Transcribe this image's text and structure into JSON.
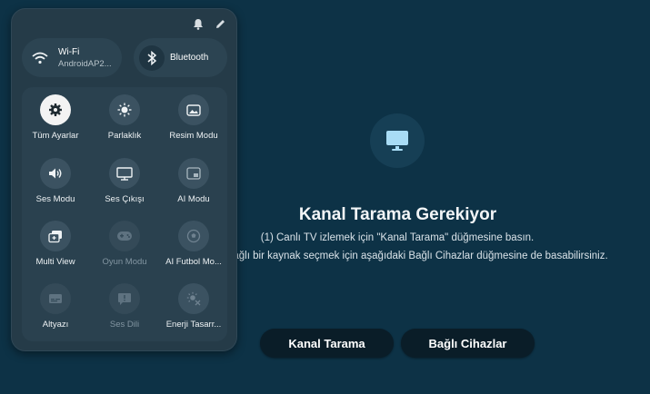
{
  "panel": {
    "wifi": {
      "title": "Wi-Fi",
      "subtitle": "AndroidAP2..."
    },
    "bluetooth": {
      "title": "Bluetooth"
    },
    "tiles": [
      {
        "label": "Tüm Ayarlar",
        "icon": "gear-icon"
      },
      {
        "label": "Parlaklık",
        "icon": "brightness-icon"
      },
      {
        "label": "Resim Modu",
        "icon": "picture-icon"
      },
      {
        "label": "Ses Modu",
        "icon": "speaker-icon"
      },
      {
        "label": "Ses Çıkışı",
        "icon": "monitor-icon"
      },
      {
        "label": "AI Modu",
        "icon": "ai-picture-icon"
      },
      {
        "label": "Multi View",
        "icon": "multi-view-icon"
      },
      {
        "label": "Oyun Modu",
        "icon": "gamepad-icon"
      },
      {
        "label": "AI Futbol Mo...",
        "icon": "football-icon"
      },
      {
        "label": "Altyazı",
        "icon": "subtitle-icon"
      },
      {
        "label": "Ses Dili",
        "icon": "speech-bubble-icon"
      },
      {
        "label": "Enerji Tasarr...",
        "icon": "energy-saving-icon"
      }
    ]
  },
  "main": {
    "title": "Kanal Tarama Gerekiyor",
    "line1": "(1) Canlı TV izlemek için \"Kanal Tarama\" düğmesine basın.",
    "line2": "bağlı bir kaynak seçmek için aşağıdaki Bağlı Cihazlar düğmesine de basabilirsiniz.",
    "scan_button": "Kanal Tarama",
    "devices_button": "Bağlı Cihazlar"
  },
  "colors": {
    "background": "#0d3246",
    "panel": "#253b48",
    "tv_icon": "#a8dcf5"
  }
}
